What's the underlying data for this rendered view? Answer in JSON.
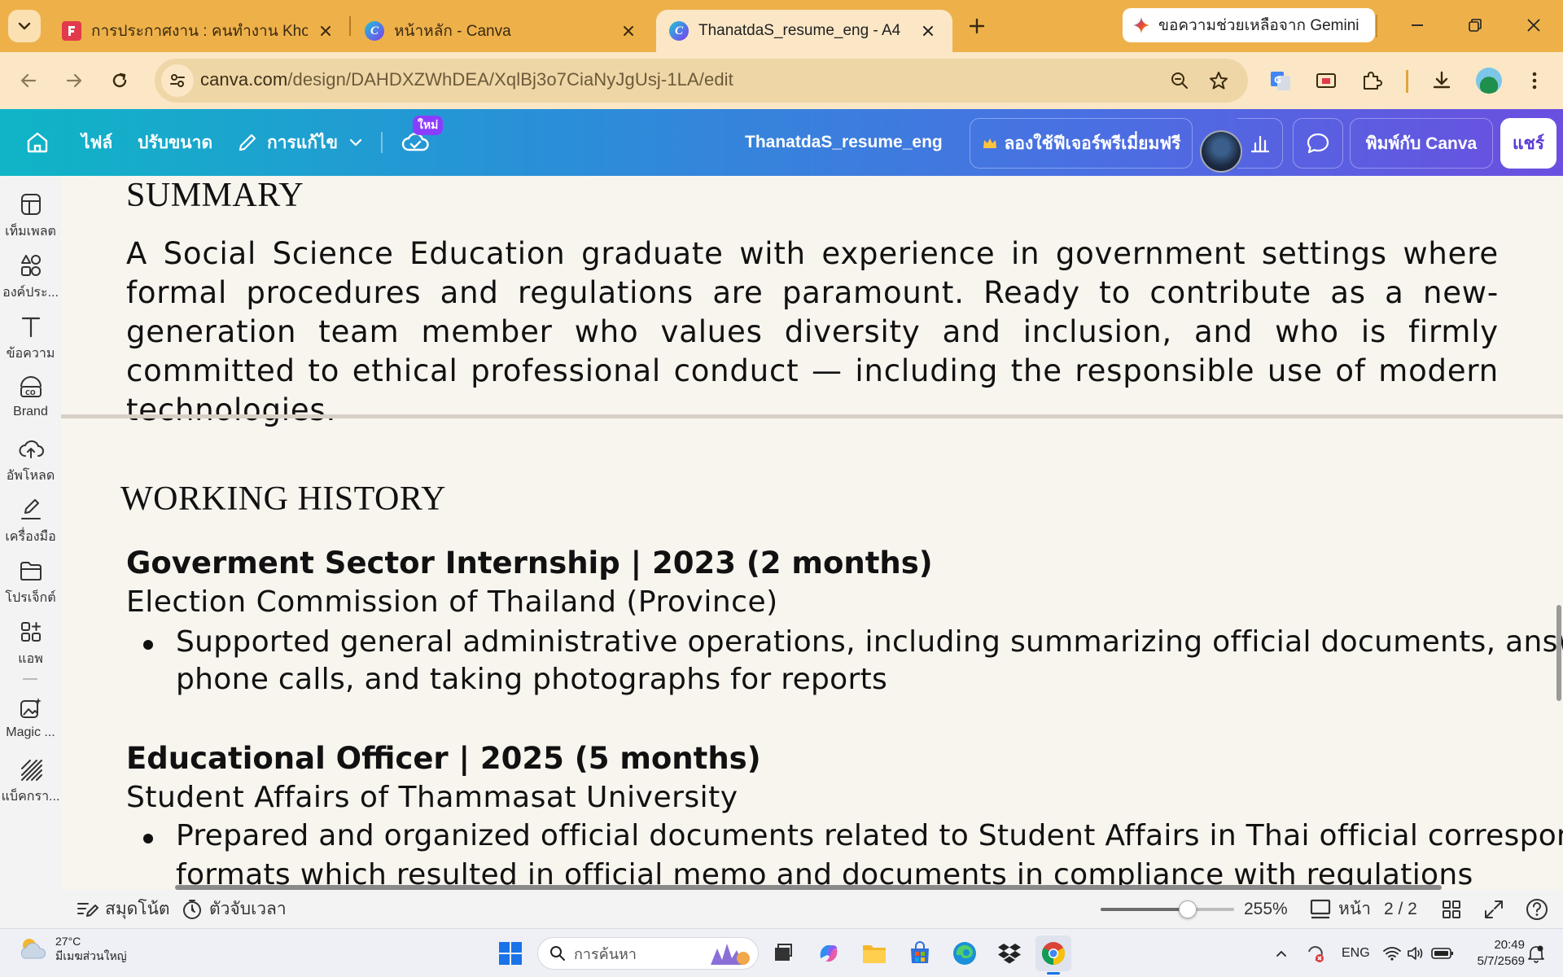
{
  "browser": {
    "tabs": [
      {
        "title": "การประกาศงาน : คนทำงาน Khon Th",
        "active": false
      },
      {
        "title": "หน้าหลัก - Canva",
        "active": false
      },
      {
        "title": "ThanatdaS_resume_eng - A4",
        "active": true
      }
    ],
    "gemini_label": "ขอความช่วยเหลือจาก Gemini",
    "url_host": "canva.com",
    "url_path": "/design/DAHDXZWhDEA/XqlBj3o7CiaNyJgUsj-1LA/edit"
  },
  "canva_header": {
    "file_label": "ไฟล์",
    "resize_label": "ปรับขนาด",
    "edit_label": "การแก้ไข",
    "new_badge": "ใหม่",
    "doc_title": "ThanatdaS_resume_eng",
    "premium_label": "ลองใช้ฟีเจอร์พรีเมี่ยมฟรี",
    "print_label": "พิมพ์กับ Canva",
    "share_label": "แชร์"
  },
  "left_rail": {
    "items": [
      {
        "label": "เท็มเพลต",
        "icon": "template-icon"
      },
      {
        "label": "องค์ประ...",
        "icon": "elements-icon"
      },
      {
        "label": "ข้อความ",
        "icon": "text-icon"
      },
      {
        "label": "Brand",
        "icon": "brand-icon"
      },
      {
        "label": "อัพโหลด",
        "icon": "upload-icon"
      },
      {
        "label": "เครื่องมือ",
        "icon": "draw-icon"
      },
      {
        "label": "โปรเจ็กต์",
        "icon": "folder-icon"
      },
      {
        "label": "แอพ",
        "icon": "apps-icon"
      },
      {
        "label": "Magic ...",
        "icon": "magic-icon"
      },
      {
        "label": "แบ็คกรา...",
        "icon": "background-icon"
      }
    ]
  },
  "document": {
    "summary_heading": "SUMMARY",
    "summary_text": "A Social Science Education graduate with experience in government settings where formal procedures and regulations are paramount. Ready to contribute as a new-generation team member who values diversity and inclusion, and who is firmly committed to ethical professional conduct — including the responsible use of modern technologies.",
    "history_heading": "WORKING HISTORY",
    "jobs": [
      {
        "title": "Goverment Sector Internship | 2023 (2 months)",
        "org": "Election Commission of Thailand (Province)",
        "bullet_line1": "Supported general administrative operations, including summarizing official documents, answerin",
        "bullet_line2": "phone calls, and taking photographs for reports"
      },
      {
        "title": "Educational Officer | 2025 (5 months)",
        "org": "Student Affairs of Thammasat University",
        "bullet_line1": "Prepared and organized official documents related to Student Affairs in Thai official corresponde",
        "bullet_line2": "formats which resulted in official memo and documents in compliance with regulations"
      }
    ]
  },
  "status_bar": {
    "notes_label": "สมุดโน้ต",
    "timer_label": "ตัวจับเวลา",
    "zoom_label": "255%",
    "zoom_fraction": 0.65,
    "pages_label": "หน้า",
    "page_count": "2 / 2"
  },
  "taskbar": {
    "temperature": "27°C",
    "weather_desc": "มีเมฆส่วนใหญ่",
    "search_placeholder": "การค้นหา",
    "language": "ENG",
    "time": "20:49",
    "date": "5/7/2569"
  },
  "colors": {
    "tabstrip": "#eeb14a",
    "toolbar": "#fbe7c6",
    "canva_gradient_start": "#0fb5c6",
    "canva_gradient_end": "#6b4fe0",
    "page_bg": "#f8f4ee"
  }
}
